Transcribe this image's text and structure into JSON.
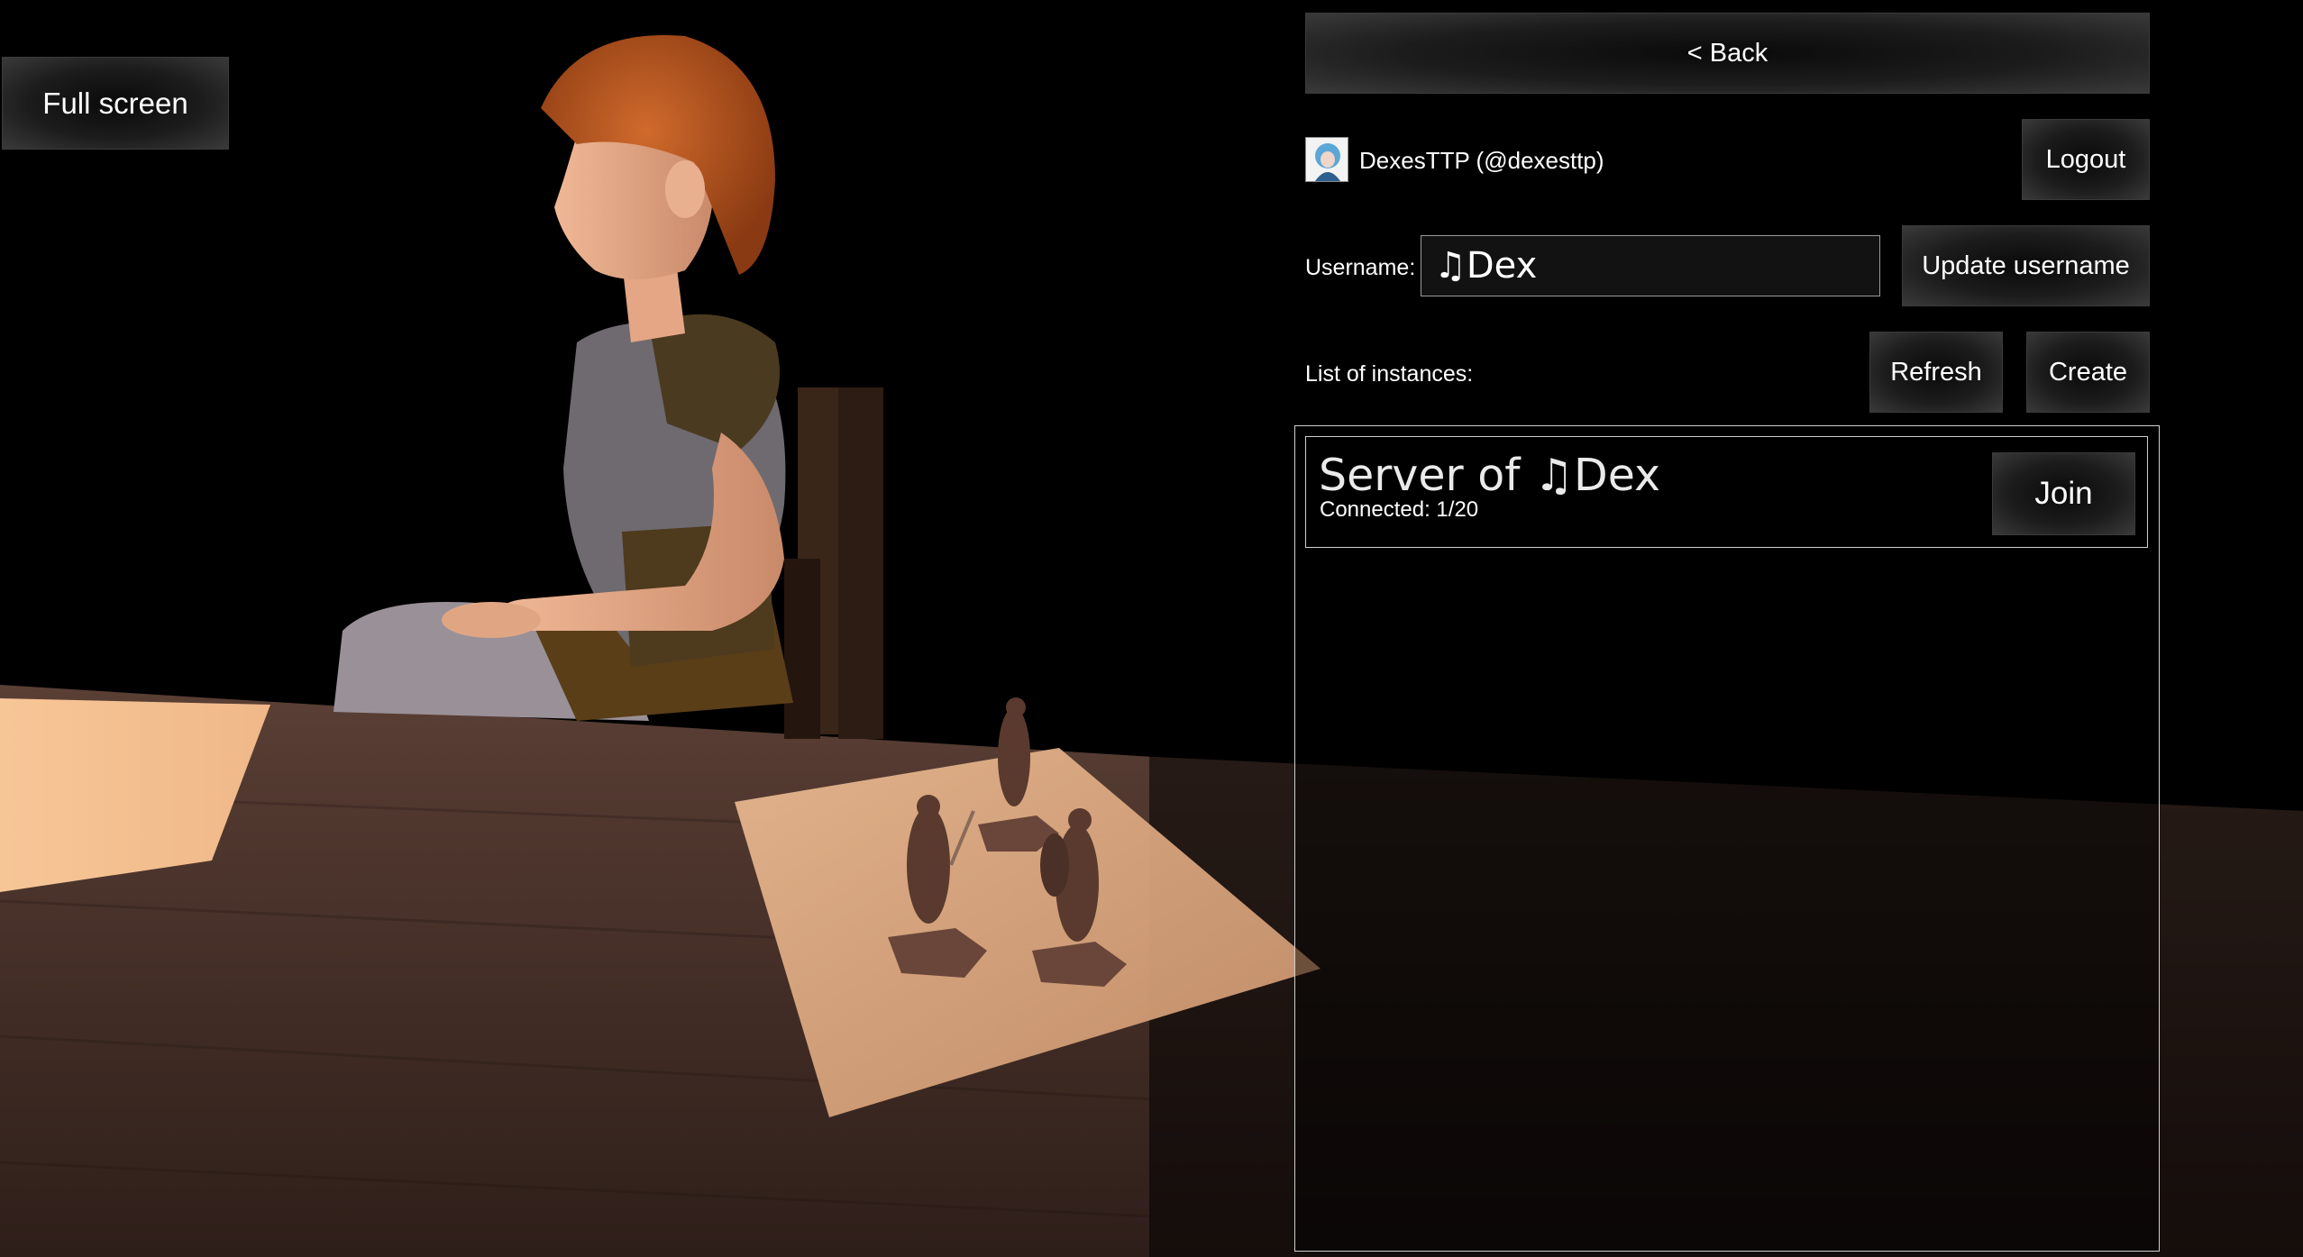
{
  "fullscreen": {
    "label": "Full screen"
  },
  "back": {
    "label": "< Back"
  },
  "user": {
    "display": "DexesTTP (@dexesttp)",
    "logout_label": "Logout"
  },
  "username": {
    "label": "Username:",
    "value": "♫Dex",
    "update_label": "Update username"
  },
  "instances": {
    "label": "List of instances:",
    "refresh_label": "Refresh",
    "create_label": "Create",
    "items": [
      {
        "name": "Server of ♫Dex",
        "connected": "Connected: 1/20",
        "join_label": "Join"
      }
    ]
  },
  "icons": {
    "avatar": "user-avatar-icon"
  }
}
